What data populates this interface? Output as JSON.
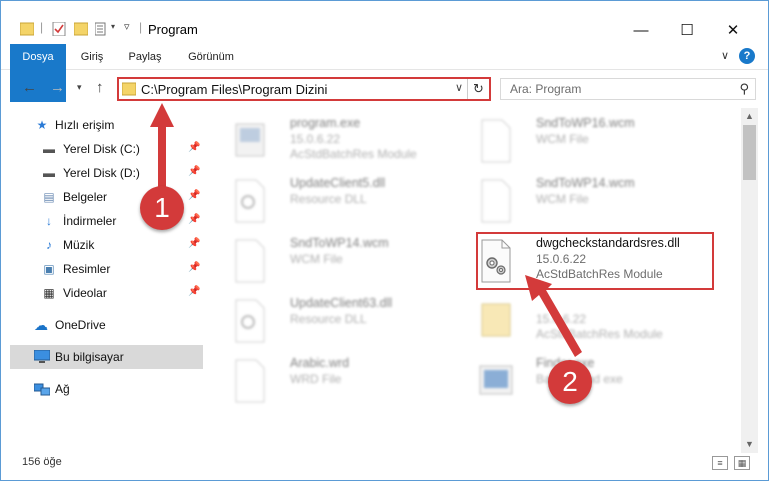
{
  "window": {
    "title": "Program",
    "minimize_label": "—",
    "maximize_label": "☐",
    "close_label": "✕"
  },
  "ribbon": {
    "tabs": [
      "Dosya",
      "Giriş",
      "Paylaş",
      "Görünüm"
    ],
    "expand_label": "∨",
    "help_label": "?"
  },
  "address": {
    "path": "C:\\Program Files\\Program Dizini",
    "dropdown_label": "∨",
    "refresh_label": "↻"
  },
  "search": {
    "placeholder": "Ara: Program",
    "icon_label": "⚲"
  },
  "sidebar": {
    "items": [
      {
        "label": "Hızlı erişim",
        "icon": "star-icon",
        "glyph": "★",
        "color": "#2b7bd6"
      },
      {
        "label": "Yerel Disk (C:)",
        "icon": "drive-icon",
        "glyph": "▬",
        "color": "#555555"
      },
      {
        "label": "Yerel Disk (D:)",
        "icon": "drive-icon",
        "glyph": "▬",
        "color": "#555555"
      },
      {
        "label": "Belgeler",
        "icon": "documents-icon",
        "glyph": "▤",
        "color": "#6a8ab3"
      },
      {
        "label": "İndirmeler",
        "icon": "download-icon",
        "glyph": "↓",
        "color": "#2b7bd6"
      },
      {
        "label": "Müzik",
        "icon": "music-icon",
        "glyph": "♪",
        "color": "#2b7bd6"
      },
      {
        "label": "Resimler",
        "icon": "pictures-icon",
        "glyph": "▣",
        "color": "#4a7fb0"
      },
      {
        "label": "Videolar",
        "icon": "videos-icon",
        "glyph": "▦",
        "color": "#333333"
      },
      {
        "label": "OneDrive",
        "icon": "cloud-icon",
        "glyph": "☁",
        "color": "#1a73c8"
      },
      {
        "label": "Bu bilgisayar",
        "icon": "computer-icon",
        "glyph": "▭",
        "color": "#2b7bd6"
      },
      {
        "label": "Ağ",
        "icon": "network-icon",
        "glyph": "⎔",
        "color": "#2b7bd6"
      }
    ]
  },
  "files": [
    {
      "name": "program.exe",
      "line2": "15.0.6.22",
      "line3": "AcStdBatchRes Module"
    },
    {
      "name": "SndToWP16.wcm",
      "line2": "WCM File",
      "line3": ""
    },
    {
      "name": "UpdateClient5.dll",
      "line2": "Resource DLL",
      "line3": ""
    },
    {
      "name": "SndToWP14.wcm",
      "line2": "WCM File",
      "line3": ""
    },
    {
      "name": "SndToWP14.wcm",
      "line2": "WCM File",
      "line3": ""
    },
    {
      "name": "dwgcheckstandardsres.dll",
      "line2": "15.0.6.22",
      "line3": "AcStdBatchRes Module"
    },
    {
      "name": "UpdateClient63.dll",
      "line2": "Resource DLL",
      "line3": ""
    },
    {
      "name": "",
      "line2": "15.0.6.22",
      "line3": "AcStdBatchRes Module"
    },
    {
      "name": "Arabic.wrd",
      "line2": "WRD File",
      "line3": ""
    },
    {
      "name": "Finder.exe",
      "line2": "Background exe",
      "line3": ""
    }
  ],
  "status": {
    "count": "156 öğe"
  },
  "callouts": [
    "1",
    "2"
  ],
  "colors": {
    "accent": "#1979ca",
    "highlight": "#d33a3a"
  }
}
